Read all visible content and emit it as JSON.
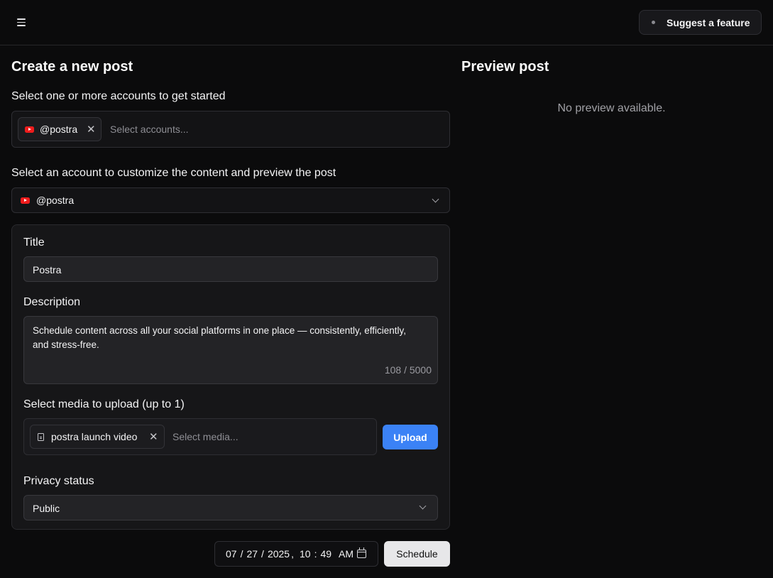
{
  "topbar": {
    "suggest_label": "Suggest a feature"
  },
  "create": {
    "heading": "Create a new post",
    "accounts_label": "Select one or more accounts to get started",
    "selected_account_chip": "@postra",
    "accounts_placeholder": "Select accounts...",
    "customize_label": "Select an account to customize the content and preview the post",
    "customize_selected": "@postra"
  },
  "form": {
    "title_label": "Title",
    "title_value": "Postra",
    "description_label": "Description",
    "description_value": "Schedule content across all your social platforms in one place — consistently, efficiently, and stress-free.",
    "char_count": "108 / 5000",
    "media_label": "Select media to upload (up to 1)",
    "media_chip": "postra launch video",
    "media_placeholder": "Select media...",
    "upload_label": "Upload",
    "privacy_label": "Privacy status",
    "privacy_value": "Public"
  },
  "schedule": {
    "month": "07",
    "day": "27",
    "year": "2025",
    "hour": "10",
    "minute": "49",
    "ampm": "AM",
    "schedule_label": "Schedule"
  },
  "preview": {
    "heading": "Preview post",
    "empty_text": "No preview available."
  },
  "colors": {
    "background": "#0b0b0c",
    "accent": "#3b82f6",
    "youtube_red": "#ef1c1c"
  },
  "icons": [
    "menu-icon",
    "dot-icon",
    "youtube-icon",
    "close-icon",
    "chevron-down-icon",
    "file-icon",
    "calendar-icon"
  ]
}
